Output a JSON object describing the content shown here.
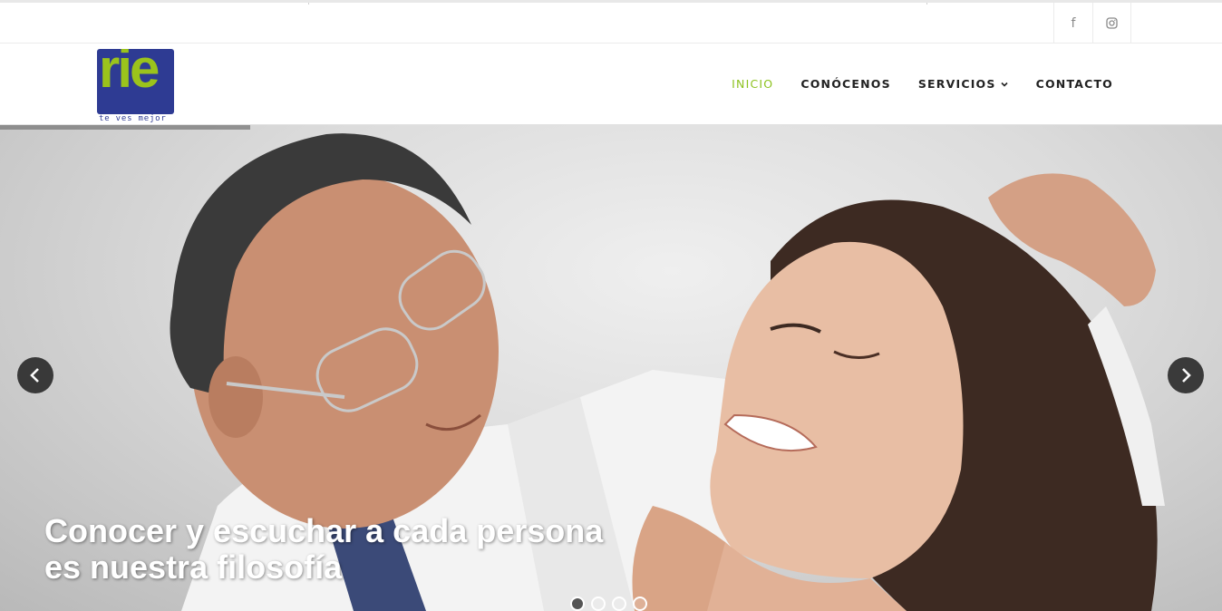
{
  "social": {
    "items": [
      {
        "icon": "facebook-icon",
        "label": "f"
      },
      {
        "icon": "instagram-icon",
        "label": ""
      }
    ]
  },
  "logo": {
    "text": "rie",
    "tagline": "te ves mejor",
    "colors": {
      "box": "#2e3b93",
      "text": "#9bc31c"
    }
  },
  "nav": {
    "items": [
      {
        "label": "INICIO",
        "active": true
      },
      {
        "label": "CONÓCENOS",
        "active": false
      },
      {
        "label": "SERVICIOS",
        "active": false,
        "dropdown": true
      },
      {
        "label": "CONTACTO",
        "active": false
      }
    ],
    "accent": "#8dc21f"
  },
  "slider": {
    "caption_line1": "Conocer y escuchar a cada persona",
    "caption_line2": "es nuestra filosofía",
    "slide_count": 4,
    "active_slide": 1
  }
}
